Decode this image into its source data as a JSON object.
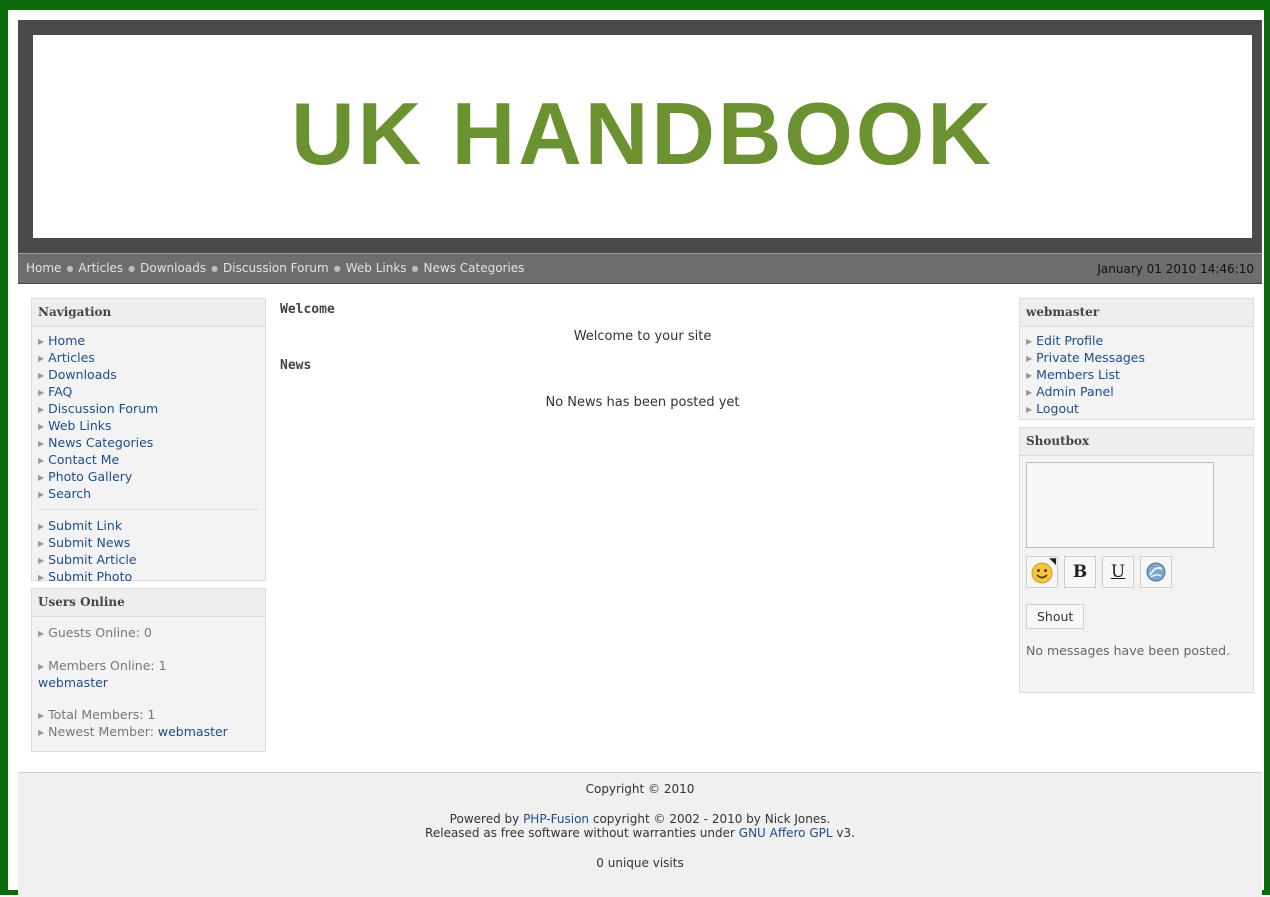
{
  "banner": {
    "title": "UK HANDBOOK"
  },
  "navbar": {
    "links": [
      "Home",
      "Articles",
      "Downloads",
      "Discussion Forum",
      "Web Links",
      "News Categories"
    ],
    "datetime": "January 01 2010 14:46:10"
  },
  "navigation": {
    "title": "Navigation",
    "items": [
      "Home",
      "Articles",
      "Downloads",
      "FAQ",
      "Discussion Forum",
      "Web Links",
      "News Categories",
      "Contact Me",
      "Photo Gallery",
      "Search"
    ],
    "submit_items": [
      "Submit Link",
      "Submit News",
      "Submit Article",
      "Submit Photo"
    ]
  },
  "users_online": {
    "title": "Users Online",
    "guests": "Guests Online: 0",
    "members": "Members Online: 1",
    "member_name": "webmaster",
    "total": "Total Members: 1",
    "newest_label": "Newest Member:",
    "newest_name": "webmaster"
  },
  "main": {
    "welcome_title": "Welcome",
    "welcome_text": "Welcome to your site",
    "news_title": "News",
    "news_text": "No News has been posted yet"
  },
  "user_panel": {
    "title": "webmaster",
    "items": [
      "Edit Profile",
      "Private Messages",
      "Members List",
      "Admin Panel",
      "Logout"
    ]
  },
  "shoutbox": {
    "title": "Shoutbox",
    "button": "Shout",
    "empty": "No messages have been posted.",
    "tools": [
      "smiley-icon",
      "bold-icon",
      "underline-icon",
      "link-icon"
    ]
  },
  "footer": {
    "copyright": "Copyright © 2010",
    "powered_prefix": "Powered by",
    "powered_link": "PHP-Fusion",
    "powered_suffix": "copyright © 2002 - 2010 by Nick Jones.",
    "released_prefix": "Released as free software without warranties under",
    "released_link": "GNU Affero GPL",
    "released_suffix": "v3.",
    "visits": "0 unique visits"
  }
}
